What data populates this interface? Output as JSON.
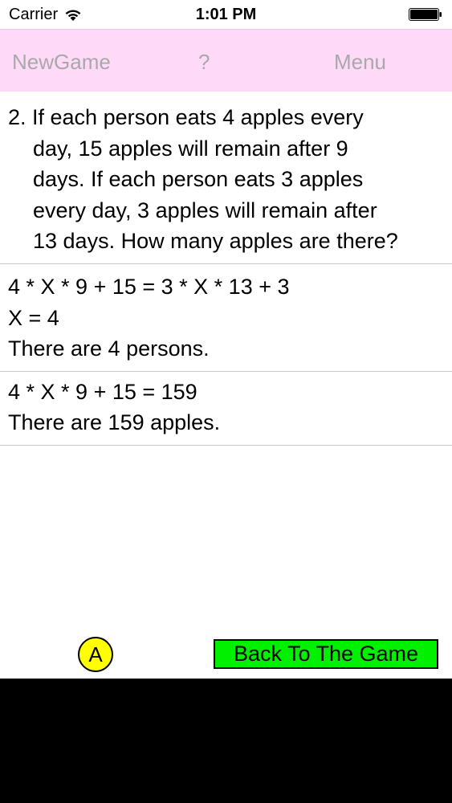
{
  "status_bar": {
    "carrier": "Carrier",
    "time": "1:01 PM",
    "wifi_icon": "wifi-icon",
    "battery_icon": "battery-icon"
  },
  "nav": {
    "new_game": "NewGame",
    "help": "?",
    "menu": "Menu",
    "background": "#ffd9f8",
    "text_color": "#a9a9a9"
  },
  "question": {
    "lines": [
      "2. If each person eats 4 apples every",
      "day, 15 apples will remain after 9",
      "days. If each person eats 3 apples",
      "every day, 3 apples will remain after",
      "13 days.  How many apples are there?"
    ]
  },
  "solution_1": {
    "lines": [
      "4 * X * 9 + 15 = 3 * X * 13 + 3",
      "X = 4",
      "There are 4 persons."
    ]
  },
  "solution_2": {
    "lines": [
      "4 * X * 9 + 15 = 159",
      "There are 159 apples."
    ]
  },
  "controls": {
    "answer_label": "A",
    "answer_color": "#ffff00",
    "back_label": "Back To The Game",
    "back_color": "#00f000"
  }
}
